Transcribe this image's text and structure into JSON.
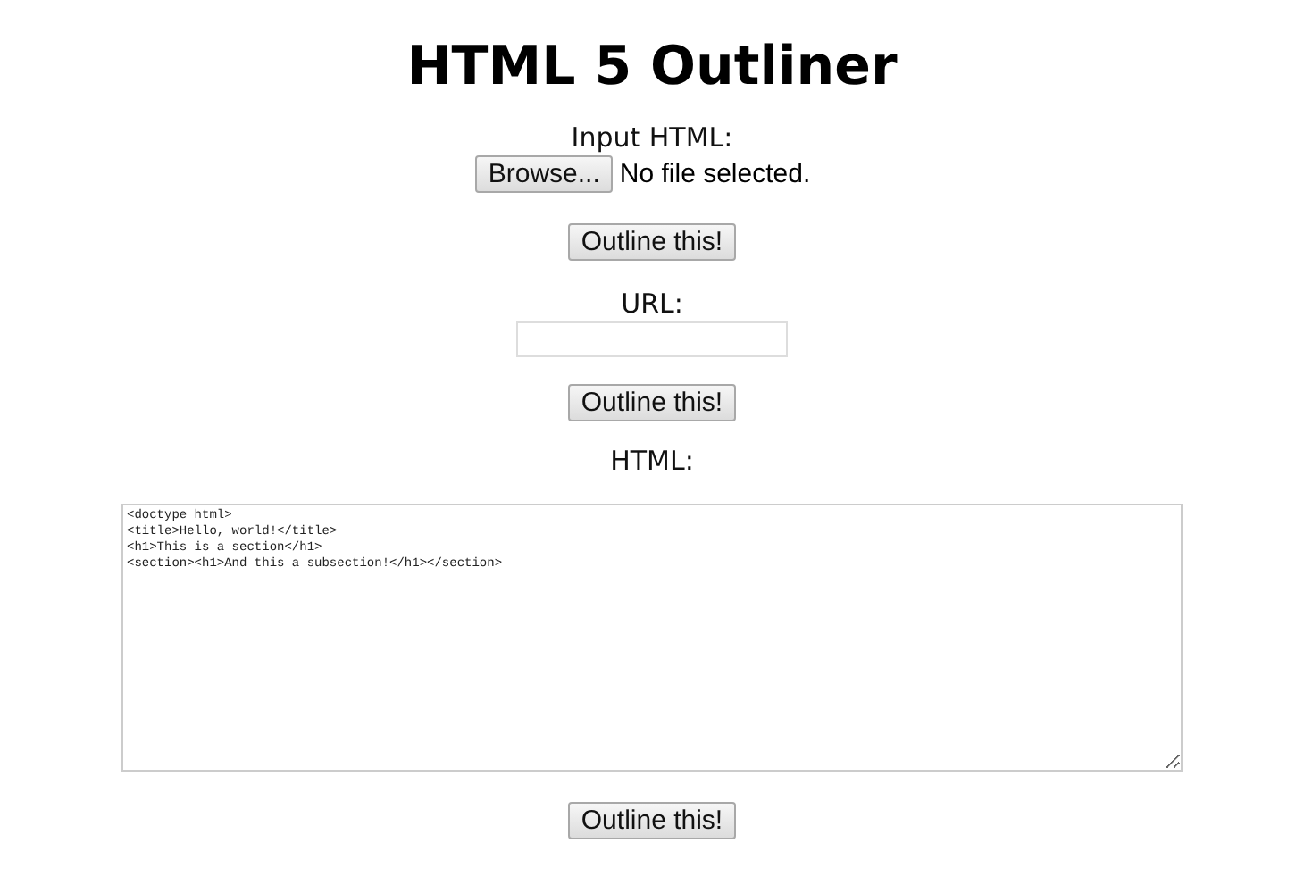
{
  "title": "HTML 5 Outliner",
  "file_section": {
    "label": "Input HTML:",
    "browse_button": "Browse...",
    "file_status": "No file selected.",
    "submit": "Outline this!"
  },
  "url_section": {
    "label": "URL:",
    "submit": "Outline this!"
  },
  "html_section": {
    "label": "HTML:",
    "value_lines": [
      "<doctype html>",
      "<title>Hello, world!</title>",
      "<h1>This is a section</h1>",
      "<section><h1>And this a subsection!</h1></section>"
    ],
    "submit": "Outline this!"
  }
}
